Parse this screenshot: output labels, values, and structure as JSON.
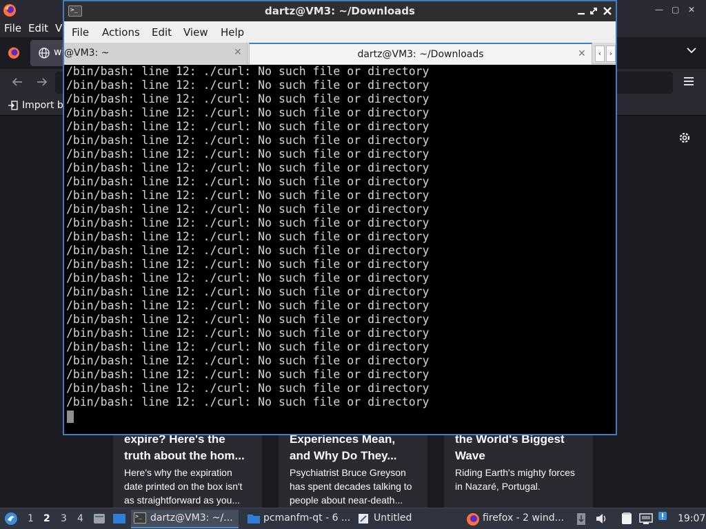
{
  "browser": {
    "menu": [
      "File",
      "Edit",
      "Vi"
    ],
    "tab_label": "wi",
    "bookmark_import": "Import b",
    "cards": [
      {
        "title_top": "expire? Here's the",
        "title_bottom": "truth about the hom...",
        "desc": [
          "Here's why the expiration",
          "date printed on the box isn't",
          "as straightforward as you..."
        ]
      },
      {
        "title_top": "Experiences Mean,",
        "title_bottom": "and Why Do They...",
        "desc": [
          "Psychiatrist Bruce Greyson",
          "has spent decades talking to",
          "people about near-death..."
        ]
      },
      {
        "title_top": "the World's Biggest",
        "title_bottom": "Wave",
        "desc": [
          "Riding Earth's mighty forces",
          "in Nazaré, Portugal."
        ]
      }
    ]
  },
  "terminal": {
    "title": "dartz@VM3: ~/Downloads",
    "menu": [
      "File",
      "Actions",
      "Edit",
      "View",
      "Help"
    ],
    "tabs": [
      {
        "label": "@VM3: ~"
      },
      {
        "label": "dartz@VM3: ~/Downloads"
      }
    ],
    "output_line": "/bin/bash: line 12: ./curl: No such file or directory",
    "output_repeat": 25
  },
  "taskbar": {
    "workspaces": [
      "1",
      "2",
      "3",
      "4"
    ],
    "active_workspace": "2",
    "tasks": [
      {
        "label": "dartz@VM3: ~/...",
        "icon": "terminal-icon"
      },
      {
        "label": "pcmanfm-qt - 6 ...",
        "icon": "folder-icon"
      },
      {
        "label": "Untitled",
        "icon": "text-editor-icon"
      },
      {
        "label": "firefox - 2 wind...",
        "icon": "firefox-icon"
      }
    ],
    "clock": "19:07"
  },
  "colors": {
    "terminal_border": "#3c7ec7",
    "terminal_bg": "#000000",
    "terminal_text": "#d6d6d6",
    "taskbar_bg": "#2f3440"
  }
}
